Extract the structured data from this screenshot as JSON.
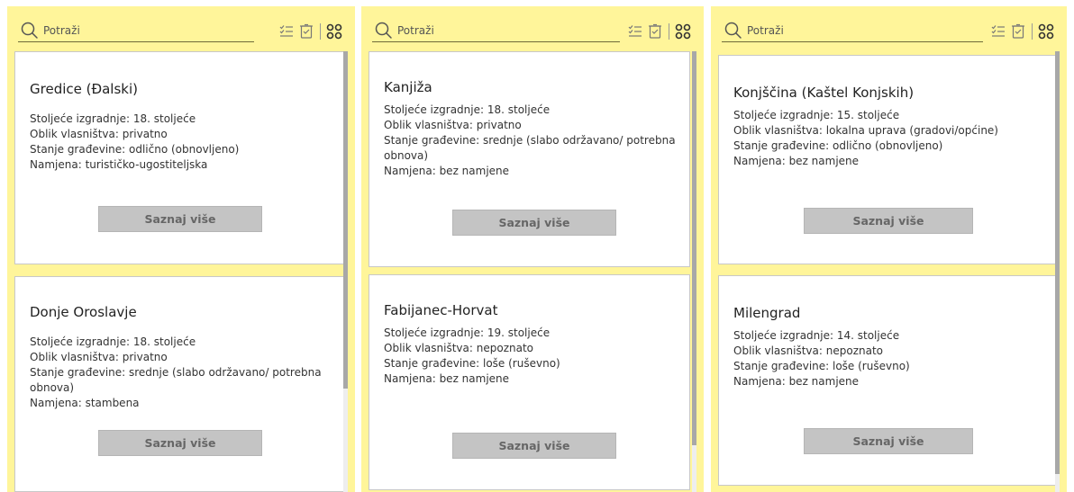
{
  "search": {
    "placeholder": "Potraži"
  },
  "labels": {
    "century": "Stoljeće izgradnje: ",
    "ownership": "Oblik vlasništva: ",
    "condition": "Stanje građevine: ",
    "purpose": "Namjena: ",
    "more": "Saznaj više"
  },
  "panels": [
    {
      "cards": [
        {
          "title": "Gredice (Đalski)",
          "century": "18. stoljeće",
          "ownership": "privatno",
          "condition": "odlično (obnovljeno)",
          "purpose": "turističko-ugostiteljska"
        },
        {
          "title": "Donje Oroslavje",
          "century": "18. stoljeće",
          "ownership": "privatno",
          "condition": "srednje (slabo održavano/ potrebna obnova)",
          "purpose": "stambena"
        }
      ]
    },
    {
      "cards": [
        {
          "title": "Kanjiža",
          "century": "18. stoljeće",
          "ownership": "privatno",
          "condition": "srednje (slabo održavano/ potrebna obnova)",
          "purpose": "bez namjene"
        },
        {
          "title": "Fabijanec-Horvat",
          "century": "19. stoljeće",
          "ownership": "nepoznato",
          "condition": "loše (ruševno)",
          "purpose": "bez namjene"
        }
      ]
    },
    {
      "cards": [
        {
          "title": "Konjščina (Kaštel Konjskih)",
          "century": "15. stoljeće",
          "ownership": "lokalna uprava (gradovi/općine)",
          "condition": "odlično (obnovljeno)",
          "purpose": "bez namjene"
        },
        {
          "title": "Milengrad",
          "century": "14. stoljeće",
          "ownership": "nepoznato",
          "condition": "loše (ruševno)",
          "purpose": "bez namjene"
        }
      ]
    }
  ],
  "icons": {
    "search": "search-icon",
    "select": "checklist-icon",
    "clear": "clear-selection-icon",
    "layout": "grid-layout-icon"
  },
  "colors": {
    "panel_bg": "#fff59a",
    "card_bg": "#ffffff",
    "button_bg": "#c4c4c4",
    "button_text": "#666666"
  }
}
